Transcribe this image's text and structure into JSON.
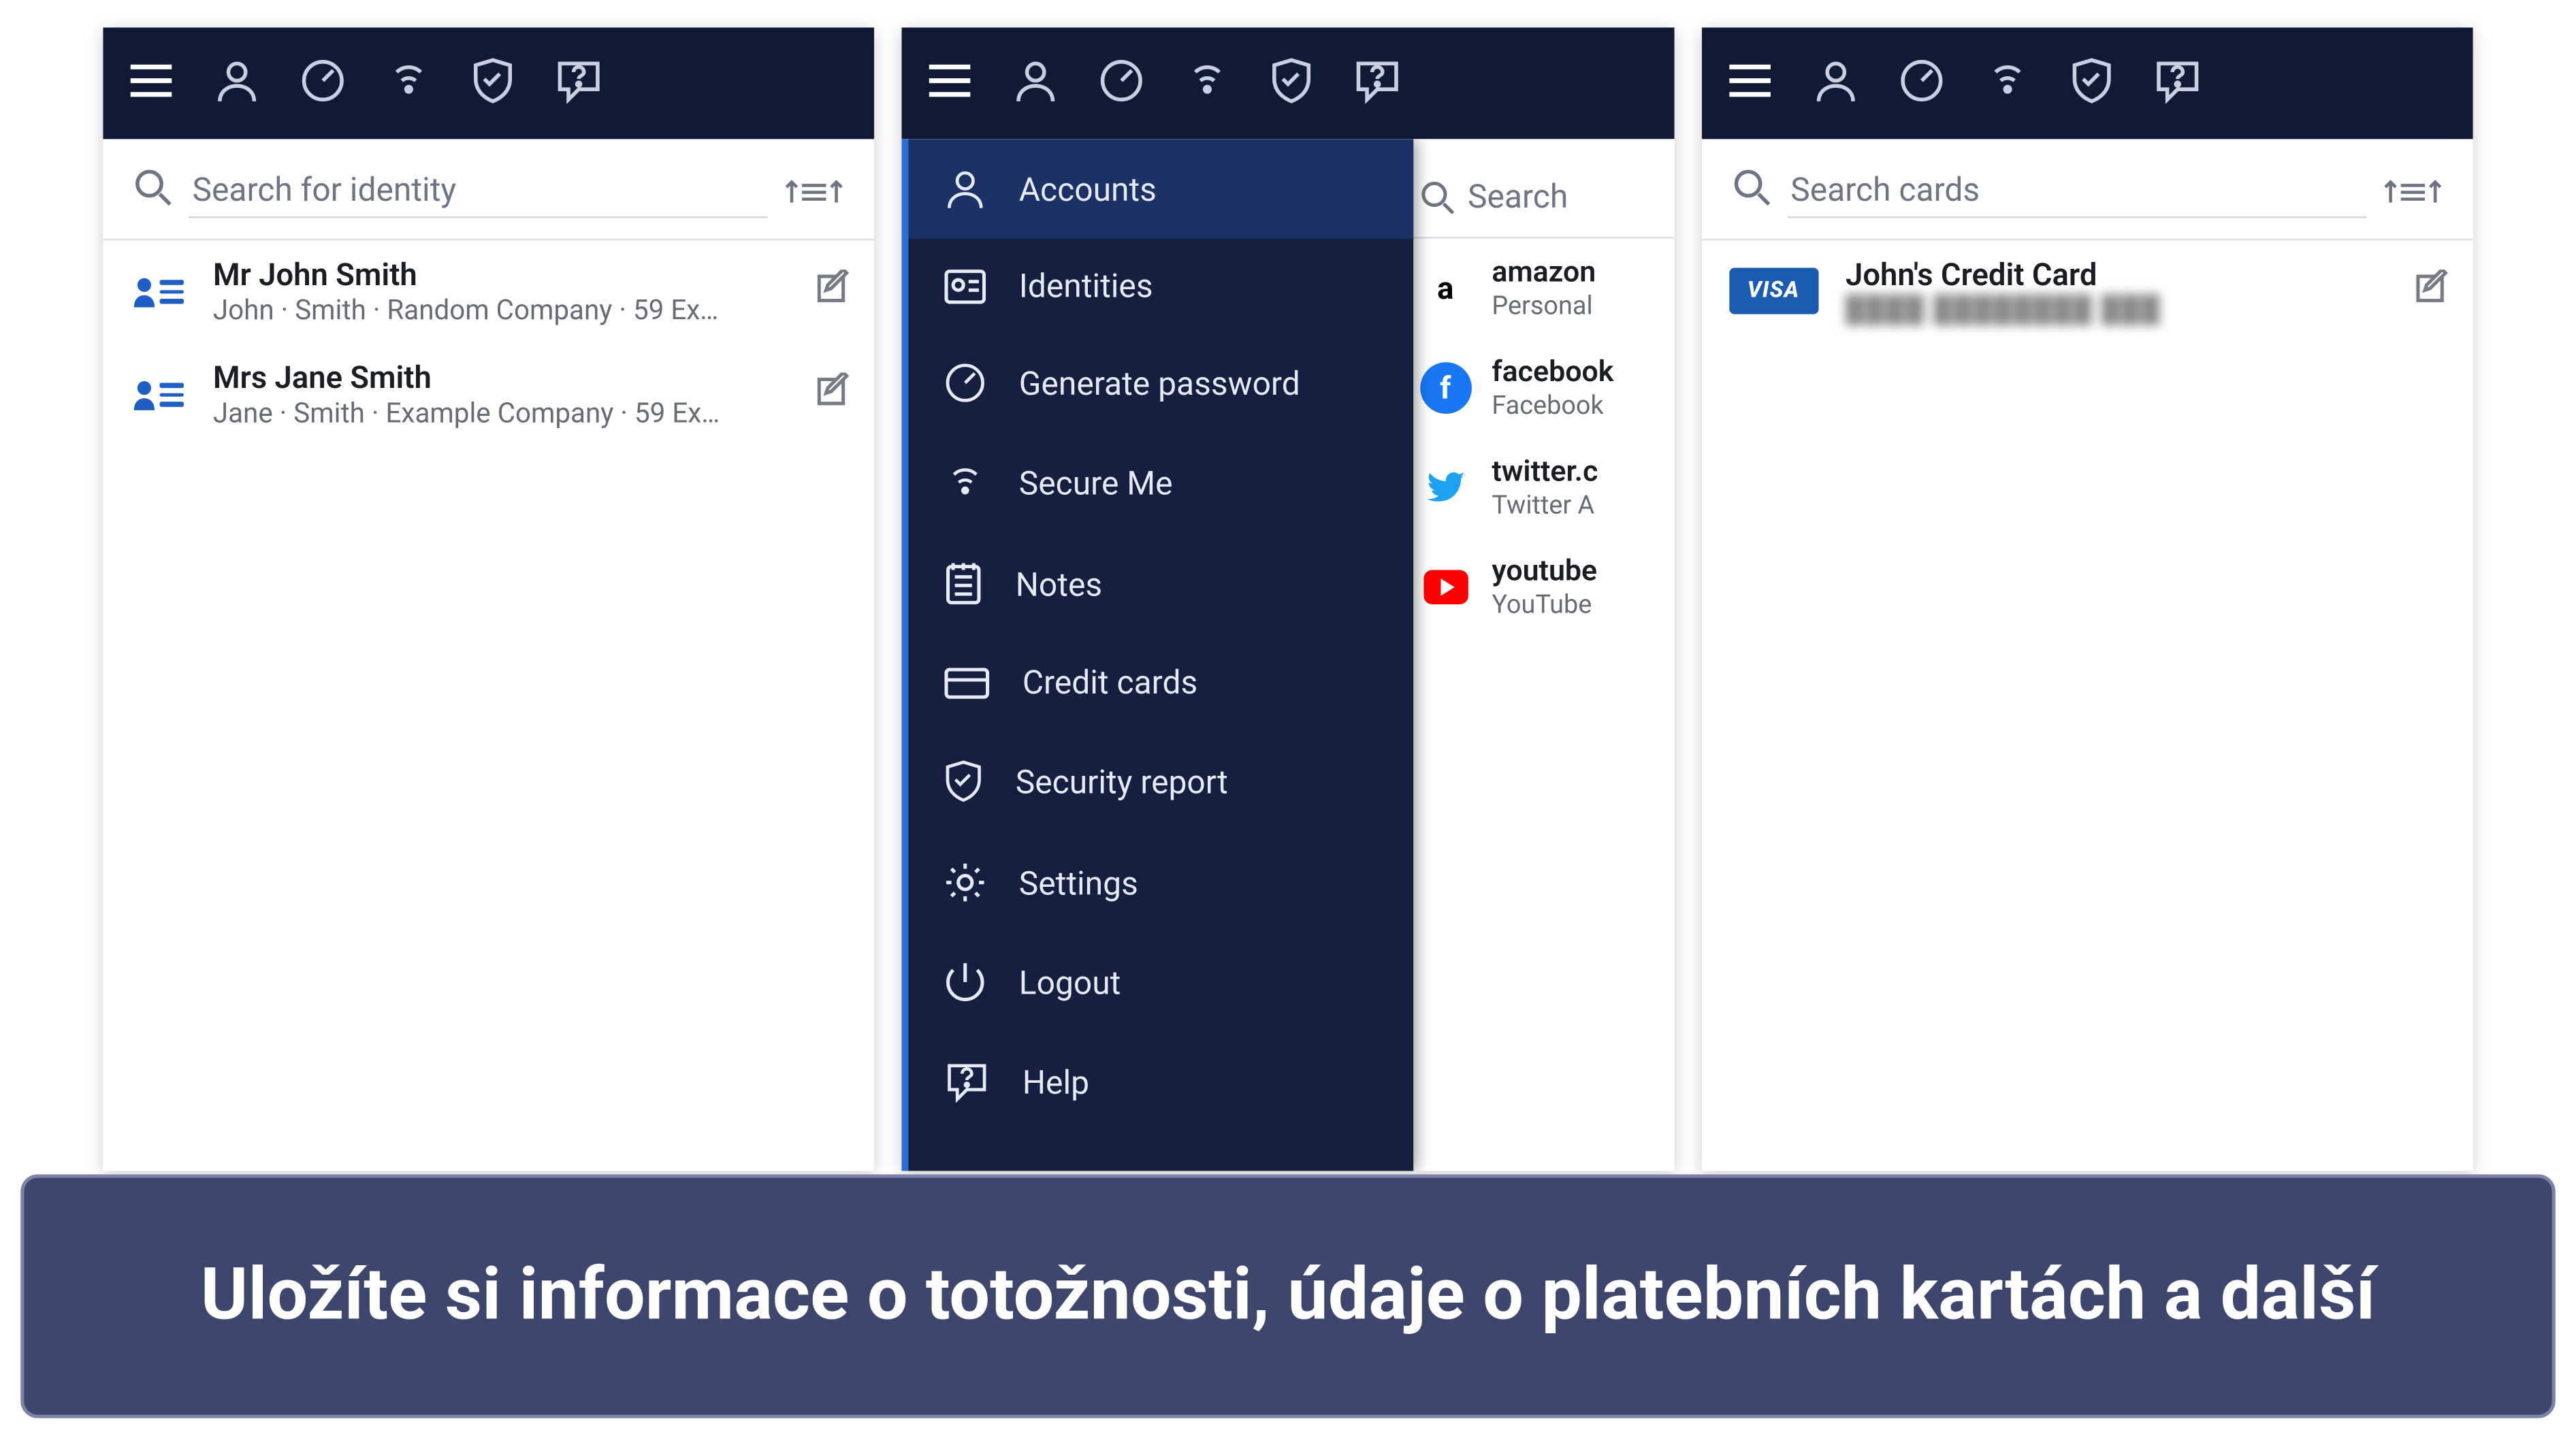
{
  "panel1": {
    "search_placeholder": "Search for identity",
    "items": [
      {
        "title": "Mr John Smith",
        "sub": "John · Smith · Random Company · 59 Ex…"
      },
      {
        "title": "Mrs Jane Smith",
        "sub": "Jane · Smith · Example Company · 59 Ex…"
      }
    ]
  },
  "panel2": {
    "behind_search_label": "Search",
    "drawer": [
      {
        "label": "Accounts",
        "icon": "person-icon",
        "active": true
      },
      {
        "label": "Identities",
        "icon": "id-card-icon"
      },
      {
        "label": "Generate password",
        "icon": "dial-icon"
      },
      {
        "label": "Secure Me",
        "icon": "signal-icon"
      },
      {
        "label": "Notes",
        "icon": "notes-icon"
      },
      {
        "label": "Credit cards",
        "icon": "card-icon"
      },
      {
        "label": "Security report",
        "icon": "shield-icon"
      },
      {
        "label": "Settings",
        "icon": "gear-icon"
      },
      {
        "label": "Logout",
        "icon": "power-icon"
      },
      {
        "label": "Help",
        "icon": "help-icon"
      }
    ],
    "behind": [
      {
        "title": "amazon",
        "sub": "Personal",
        "brand": "amazon"
      },
      {
        "title": "facebook",
        "sub": "Facebook",
        "brand": "facebook"
      },
      {
        "title": "twitter.c",
        "sub": "Twitter A",
        "brand": "twitter"
      },
      {
        "title": "youtube",
        "sub": "YouTube",
        "brand": "youtube"
      }
    ]
  },
  "panel3": {
    "search_placeholder": "Search cards",
    "items": [
      {
        "title": "John's Credit Card",
        "sub_masked": "████  ████████  ███"
      }
    ]
  },
  "caption": "Uložíte si informace o totožnosti, údaje o platebních kartách a další"
}
